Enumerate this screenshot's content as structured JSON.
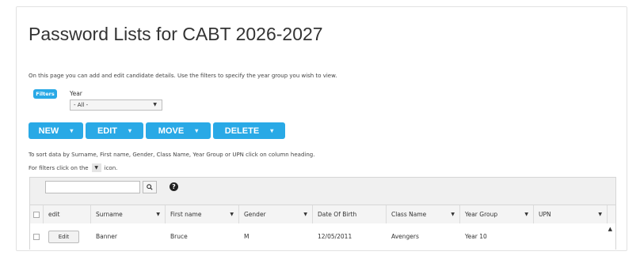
{
  "page": {
    "title": "Password Lists for CABT 2026-2027",
    "intro": "On this page you can add and edit candidate details. Use the filters to specify the year group you wish to view."
  },
  "filters": {
    "button_label": "Filters",
    "year_label": "Year",
    "year_value": "- All -"
  },
  "actions": [
    {
      "label": "NEW"
    },
    {
      "label": "EDIT"
    },
    {
      "label": "MOVE"
    },
    {
      "label": "DELETE"
    }
  ],
  "notes": {
    "sort": "To sort data by Surname, First name, Gender, Class Name, Year Group or UPN click on column heading.",
    "filter_prefix": "For filters click on the",
    "filter_suffix": "icon."
  },
  "toolbar": {
    "search_value": "",
    "help_glyph": "?"
  },
  "table": {
    "columns": [
      "edit",
      "Surname",
      "First name",
      "Gender",
      "Date Of Birth",
      "Class Name",
      "Year Group",
      "UPN"
    ],
    "rows": [
      {
        "edit_label": "Edit",
        "surname": "Banner",
        "first_name": "Bruce",
        "gender": "M",
        "dob": "12/05/2011",
        "class_name": "Avengers",
        "year_group": "Year 10",
        "upn": ""
      }
    ]
  },
  "colors": {
    "accent": "#29a9e6",
    "header_bg": "#f4f4f4",
    "grid_border": "#d6d6d6"
  },
  "icons": {
    "dropdown": "chevron-down-icon",
    "filter": "filter-icon",
    "search": "search-icon",
    "help": "help-icon",
    "scroll": "scroll-up-icon"
  }
}
